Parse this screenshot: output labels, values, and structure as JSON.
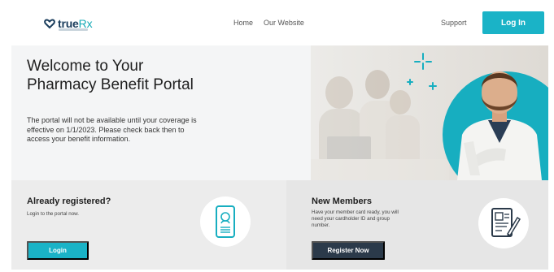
{
  "header": {
    "logo_brand": "true",
    "logo_rx": "Rx",
    "nav": {
      "home": "Home",
      "website": "Our Website",
      "support": "Support"
    },
    "login_label": "Log In"
  },
  "hero": {
    "title": "Welcome to Your Pharmacy Benefit Portal",
    "text": "The portal will not be available until your coverage is effective on 1/1/2023. Please check back then to access your benefit information."
  },
  "registered": {
    "title": "Already registered?",
    "text": "Login to the portal now.",
    "button": "Login"
  },
  "new_members": {
    "title": "New Members",
    "text": "Have your member card ready, you will need your cardholder ID and group number.",
    "button": "Register Now"
  },
  "colors": {
    "accent": "#1ab3c7",
    "dark_button": "#2b3a4a",
    "brand_navy": "#1a3d5c"
  },
  "icons": [
    "heart-logo-icon",
    "phone-id-icon",
    "clipboard-pen-icon",
    "sparkle-icon"
  ]
}
